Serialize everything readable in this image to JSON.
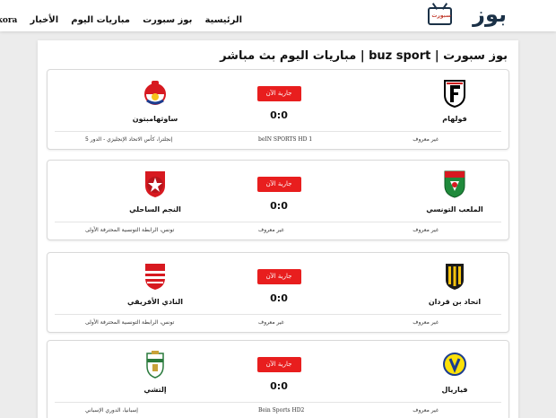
{
  "header": {
    "logo_text": "بوز",
    "logo_sub": "سبورت",
    "nav": [
      "الرئيسية",
      "بوز سبورت",
      "مباريات اليوم",
      "الأخبار",
      "buz kora"
    ]
  },
  "page_title": "بوز سبورت | buz sport | مباريات اليوم بث مباشر",
  "matches": [
    {
      "home": "فولهام",
      "away": "ساوثهامبتون",
      "status": "جارية الآن",
      "score": "0:0",
      "commentator": "غير معروف",
      "channel": "beIN SPORTS HD 1",
      "league": "إنجلترا، كأس الاتحاد الإنجليزي - الدور 5"
    },
    {
      "home": "الملعب التونسي",
      "away": "النجم الساحلي",
      "status": "جارية الآن",
      "score": "0:0",
      "commentator": "غير معروف",
      "channel": "غير معروف",
      "league": "تونس، الرابطة التونسية المحترفة الأولى"
    },
    {
      "home": "اتحاد بن قردان",
      "away": "النادي الأفريقي",
      "status": "جارية الآن",
      "score": "0:0",
      "commentator": "غير معروف",
      "channel": "غير معروف",
      "league": "تونس، الرابطة التونسية المحترفة الأولى"
    },
    {
      "home": "فياريال",
      "away": "إلتشي",
      "status": "جارية الآن",
      "score": "0:0",
      "commentator": "غير معروف",
      "channel": "Bein Sports HD2",
      "league": "إسبانيا، الدوري الإسباني"
    }
  ],
  "colors": {
    "live": "#e81e1e",
    "brand": "#1b3147"
  }
}
